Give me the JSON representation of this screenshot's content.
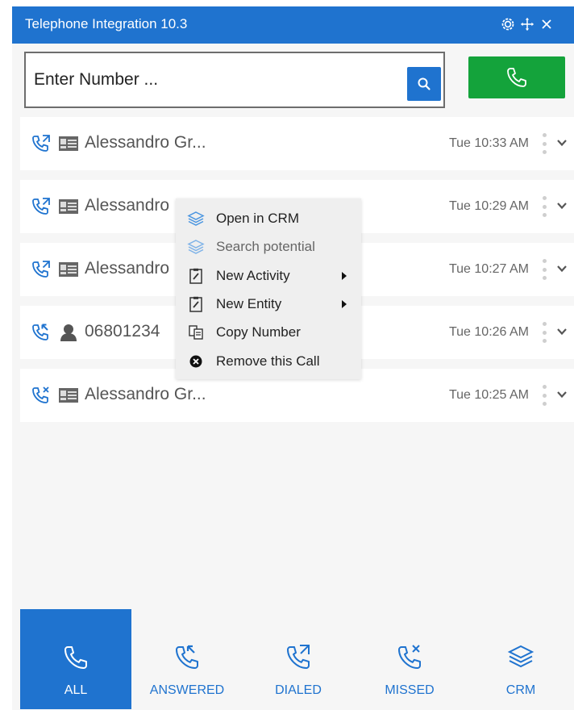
{
  "window": {
    "title": "Telephone Integration 10.3",
    "controls": [
      "settings-icon",
      "move-icon",
      "close-icon"
    ]
  },
  "dialer": {
    "placeholder": "Enter Number ...",
    "search_icon": "search-icon",
    "call_icon": "phone-icon"
  },
  "calls": [
    {
      "direction": "dialed",
      "contact_type": "crm-card",
      "name": "Alessandro Gr...",
      "time": "Tue 10:33 AM"
    },
    {
      "direction": "dialed",
      "contact_type": "crm-card",
      "name": "Alessandro",
      "time": "Tue 10:29 AM"
    },
    {
      "direction": "dialed",
      "contact_type": "crm-card",
      "name": "Alessandro",
      "time": "Tue 10:27 AM"
    },
    {
      "direction": "answered",
      "contact_type": "unknown-person",
      "name": "06801234",
      "time": "Tue 10:26 AM"
    },
    {
      "direction": "missed",
      "contact_type": "crm-card",
      "name": "Alessandro Gr...",
      "time": "Tue 10:25 AM"
    }
  ],
  "context_menu": {
    "items": [
      {
        "label": "Open in CRM",
        "icon": "layers-icon"
      },
      {
        "label": "Search potential",
        "icon": "layers-icon",
        "disabled": true
      },
      {
        "label": "New Activity",
        "icon": "clipboard-icon",
        "submenu": true
      },
      {
        "label": "New Entity",
        "icon": "clipboard-icon",
        "submenu": true
      },
      {
        "label": "Copy Number",
        "icon": "copy-icon"
      },
      {
        "label": "Remove this Call",
        "icon": "remove-icon"
      }
    ]
  },
  "nav": {
    "tabs": [
      {
        "label": "ALL",
        "icon": "phone-icon",
        "active": true
      },
      {
        "label": "ANSWERED",
        "icon": "answered-icon"
      },
      {
        "label": "DIALED",
        "icon": "dialed-icon"
      },
      {
        "label": "MISSED",
        "icon": "missed-icon"
      },
      {
        "label": "CRM",
        "icon": "layers-icon"
      }
    ]
  },
  "colors": {
    "accent": "#1f73cf",
    "call_green": "#14a33b",
    "panel_bg": "#f6f6f6"
  }
}
